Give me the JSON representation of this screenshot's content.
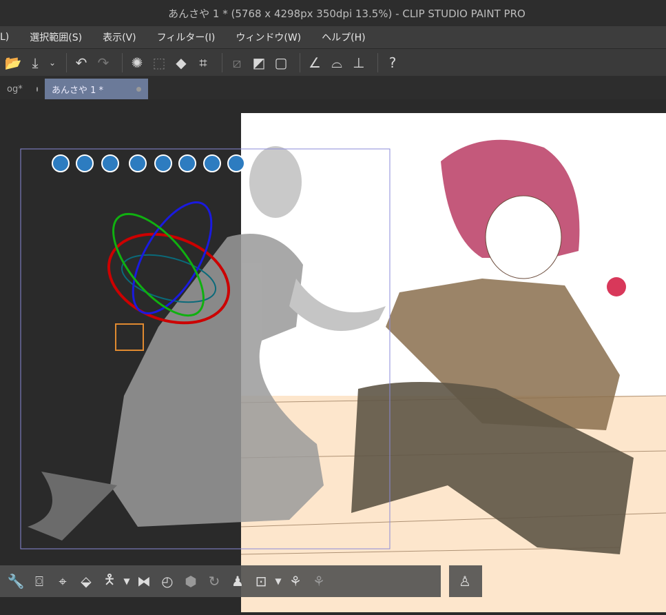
{
  "window": {
    "title": "あんさや 1 * (5768 x 4298px 350dpi 13.5%)  - CLIP STUDIO PAINT PRO"
  },
  "menu": [
    "L)",
    "選択範囲(S)",
    "表示(V)",
    "フィルター(I)",
    "ウィンドウ(W)",
    "ヘルプ(H)"
  ],
  "tabs": [
    {
      "label": "og*"
    },
    {
      "label": "あんさや 1 *"
    }
  ],
  "colors": {
    "accent_tab": "#6b7a99",
    "canvas_bg": "#2a2a2a",
    "paper": "#ffffff",
    "floor": "#fde6cc"
  }
}
